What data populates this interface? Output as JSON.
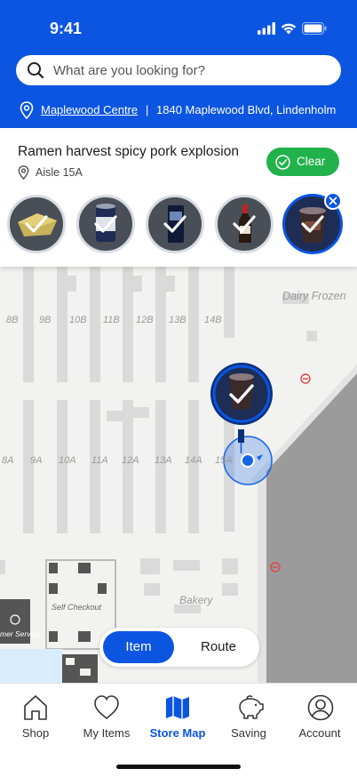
{
  "status": {
    "time": "9:41"
  },
  "search": {
    "placeholder": "What are you looking for?"
  },
  "store": {
    "name": "Maplewood Centre",
    "separator": "|",
    "address": "1840 Maplewood Blvd, Lindenholm"
  },
  "item": {
    "title": "Ramen harvest spicy pork explosion",
    "aisle": "Aisle 15A",
    "clear_label": "Clear"
  },
  "thumbnails": [
    {
      "icon": "food-container-icon",
      "checked": true,
      "selected": false
    },
    {
      "icon": "canned-can-icon",
      "checked": true,
      "selected": false
    },
    {
      "icon": "canned-tin-icon",
      "checked": true,
      "selected": false
    },
    {
      "icon": "sauce-bottle-icon",
      "checked": true,
      "selected": false
    },
    {
      "icon": "ramen-cup-icon",
      "checked": true,
      "selected": true
    }
  ],
  "map": {
    "section_labels": [
      "Dairy Frozen",
      "Self Checkout",
      "Bakery",
      "mer Service"
    ],
    "aisles_top": [
      "8B",
      "9B",
      "10B",
      "11B",
      "12B",
      "13B",
      "14B"
    ],
    "aisles_mid": [
      "8A",
      "9A",
      "10A",
      "11A",
      "12A",
      "13A",
      "14A",
      "15A"
    ]
  },
  "map_toggle": {
    "item_label": "Item",
    "route_label": "Route",
    "active": "Item"
  },
  "tabs": [
    {
      "label": "Shop",
      "icon": "home-icon",
      "active": false
    },
    {
      "label": "My Items",
      "icon": "heart-icon",
      "active": false
    },
    {
      "label": "Store Map",
      "icon": "map-icon",
      "active": true
    },
    {
      "label": "Saving",
      "icon": "piggy-bank-icon",
      "active": false
    },
    {
      "label": "Account",
      "icon": "account-icon",
      "active": false
    }
  ],
  "colors": {
    "brand_blue": "#0b55e0",
    "success_green": "#22b24c",
    "location_blue": "#1565e8"
  }
}
